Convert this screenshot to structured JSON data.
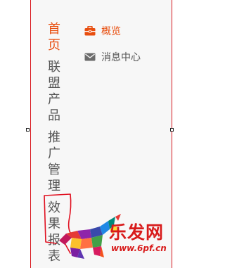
{
  "nav": {
    "items": [
      {
        "label": "首页",
        "active": true
      },
      {
        "label": "联盟产品",
        "active": false
      },
      {
        "label": "推广管理",
        "active": false
      },
      {
        "label": "效果报表",
        "active": false
      }
    ]
  },
  "submenu": {
    "items": [
      {
        "label": "概览",
        "icon": "briefcase-icon",
        "active": true
      },
      {
        "label": "消息中心",
        "icon": "mail-icon",
        "active": false
      }
    ]
  },
  "watermark": {
    "brand": "乐发网",
    "url": "www.6pf.cn"
  },
  "colors": {
    "accent": "#e84e0f",
    "border": "#d8181f",
    "text": "#555555",
    "panel_bg": "#f7f7f7"
  }
}
